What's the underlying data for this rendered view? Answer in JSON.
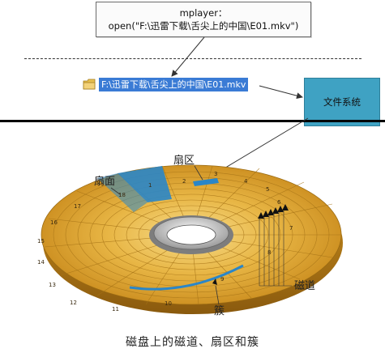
{
  "callout": {
    "line1": "mplayer：",
    "line2": "open(\"F:\\迅雷下载\\舌尖上的中国\\E01.mkv\")"
  },
  "file_entry": {
    "path": "F:\\迅雷下载\\舌尖上的中国\\E01.mkv",
    "icon": "folder-icon"
  },
  "file_system_box": {
    "label": "文件系统",
    "color": "#3fa2c3"
  },
  "disk": {
    "labels": {
      "sector": "扇面",
      "zone": "扇区",
      "track": "磁道",
      "cluster": "簇"
    },
    "sector_numbers": [
      "1",
      "2",
      "3",
      "4",
      "5",
      "6",
      "7",
      "8",
      "9",
      "10",
      "11",
      "12",
      "13",
      "14",
      "15",
      "16",
      "17",
      "18"
    ],
    "colors": {
      "disk": "#e8b645",
      "highlight": "#2a86c8"
    }
  },
  "caption": "磁盘上的磁道、扇区和簇"
}
